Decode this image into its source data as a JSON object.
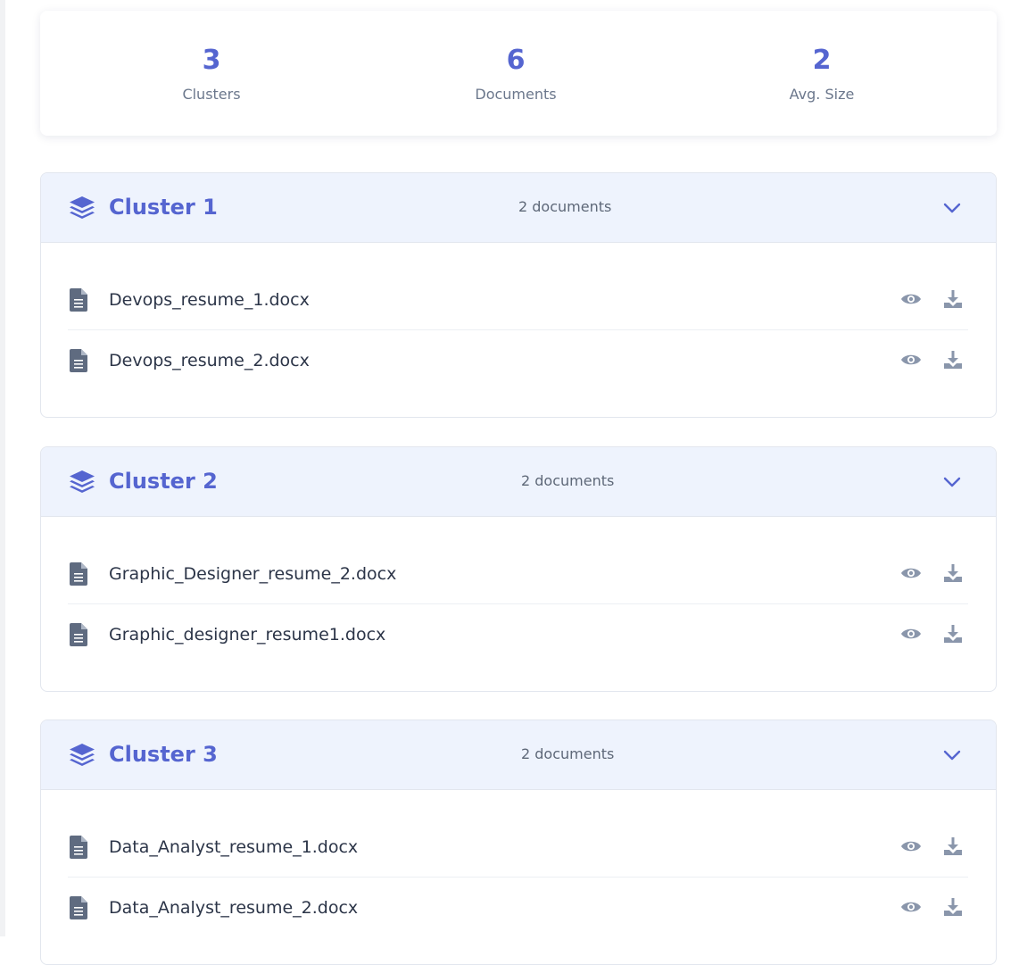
{
  "stats": [
    {
      "value": "3",
      "label": "Clusters"
    },
    {
      "value": "6",
      "label": "Documents"
    },
    {
      "value": "2",
      "label": "Avg. Size"
    }
  ],
  "clusters": [
    {
      "title": "Cluster 1",
      "doc_count": "2 documents",
      "documents": [
        {
          "name": "Devops_resume_1.docx"
        },
        {
          "name": "Devops_resume_2.docx"
        }
      ]
    },
    {
      "title": "Cluster 2",
      "doc_count": "2 documents",
      "documents": [
        {
          "name": "Graphic_Designer_resume_2.docx"
        },
        {
          "name": "Graphic_designer_resume1.docx"
        }
      ]
    },
    {
      "title": "Cluster 3",
      "doc_count": "2 documents",
      "documents": [
        {
          "name": "Data_Analyst_resume_1.docx"
        },
        {
          "name": "Data_Analyst_resume_2.docx"
        }
      ]
    }
  ],
  "icons": {
    "cluster": "layers-icon",
    "document": "file-icon",
    "view": "eye-icon",
    "download": "download-icon",
    "toggle": "chevron-down-icon"
  },
  "colors": {
    "accent": "#5565d0",
    "header_bg": "#eef3fd",
    "icon_gray": "#8a96ab",
    "file_icon": "#5f6b80",
    "text_dark": "#2c3548",
    "text_muted": "#6b778c"
  }
}
